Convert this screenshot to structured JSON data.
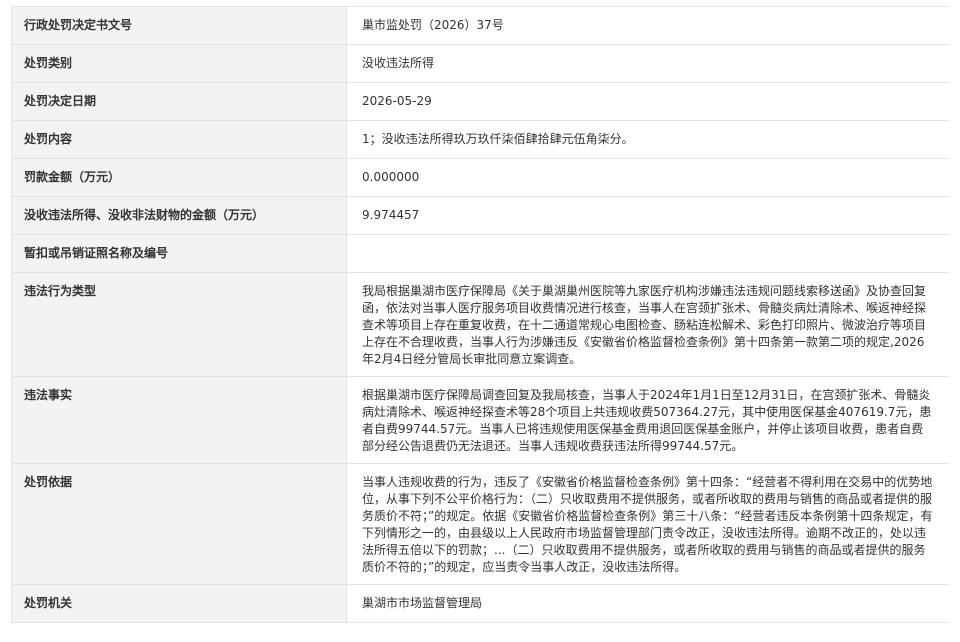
{
  "rows": [
    {
      "label": "行政处罚决定书文号",
      "value": "巢市监处罚（2026）37号"
    },
    {
      "label": "处罚类别",
      "value": "没收违法所得"
    },
    {
      "label": "处罚决定日期",
      "value": "2026-05-29"
    },
    {
      "label": "处罚内容",
      "value": "1；没收违法所得玖万玖仟柒佰肆拾肆元伍角柒分。"
    },
    {
      "label": "罚款金额（万元）",
      "value": "0.000000"
    },
    {
      "label": "没收违法所得、没收非法财物的金额（万元）",
      "value": "9.974457"
    },
    {
      "label": "暂扣或吊销证照名称及编号",
      "value": ""
    },
    {
      "label": "违法行为类型",
      "value": "我局根据巢湖市医疗保障局《关于巢湖巢州医院等九家医疗机构涉嫌违法违规问题线索移送函》及协查回复函，依法对当事人医疗服务项目收费情况进行核查，当事人在宫颈扩张术、骨髓炎病灶清除术、喉返神经探查术等项目上存在重复收费，在十二通道常规心电图检查、肠粘连松解术、彩色打印照片、微波治疗等项目上存在不合理收费，当事人行为涉嫌违反《安徽省价格监督检查条例》第十四条第一款第二项的规定,2026年2月4日经分管局长审批同意立案调查。"
    },
    {
      "label": "违法事实",
      "value": "根据巢湖市医疗保障局调查回复及我局核查，当事人于2024年1月1日至12月31日，在宫颈扩张术、骨髓炎病灶清除术、喉返神经探查术等28个项目上共违规收费507364.27元，其中使用医保基金407619.7元，患者自费99744.57元。当事人已将违规使用医保基金费用退回医保基金账户，并停止该项目收费，患者自费部分经公告退费仍无法退还。当事人违规收费获违法所得99744.57元。"
    },
    {
      "label": "处罚依据",
      "value": "当事人违规收费的行为，违反了《安徽省价格监督检查条例》第十四条：“经营者不得利用在交易中的优势地位，从事下列不公平价格行为：（二）只收取费用不提供服务，或者所收取的费用与销售的商品或者提供的服务质价不符；”的规定。依据《安徽省价格监督检查条例》第三十八条：“经营者违反本条例第十四条规定，有下列情形之一的，由县级以上人民政府市场监督管理部门责令改正，没收违法所得。逾期不改正的，处以违法所得五倍以下的罚款；...（二）只收取费用不提供服务，或者所收取的费用与销售的商品或者提供的服务质价不符的；”的规定，应当责令当事人改正，没收违法所得。"
    },
    {
      "label": "处罚机关",
      "value": "巢湖市市场监督管理局"
    }
  ]
}
